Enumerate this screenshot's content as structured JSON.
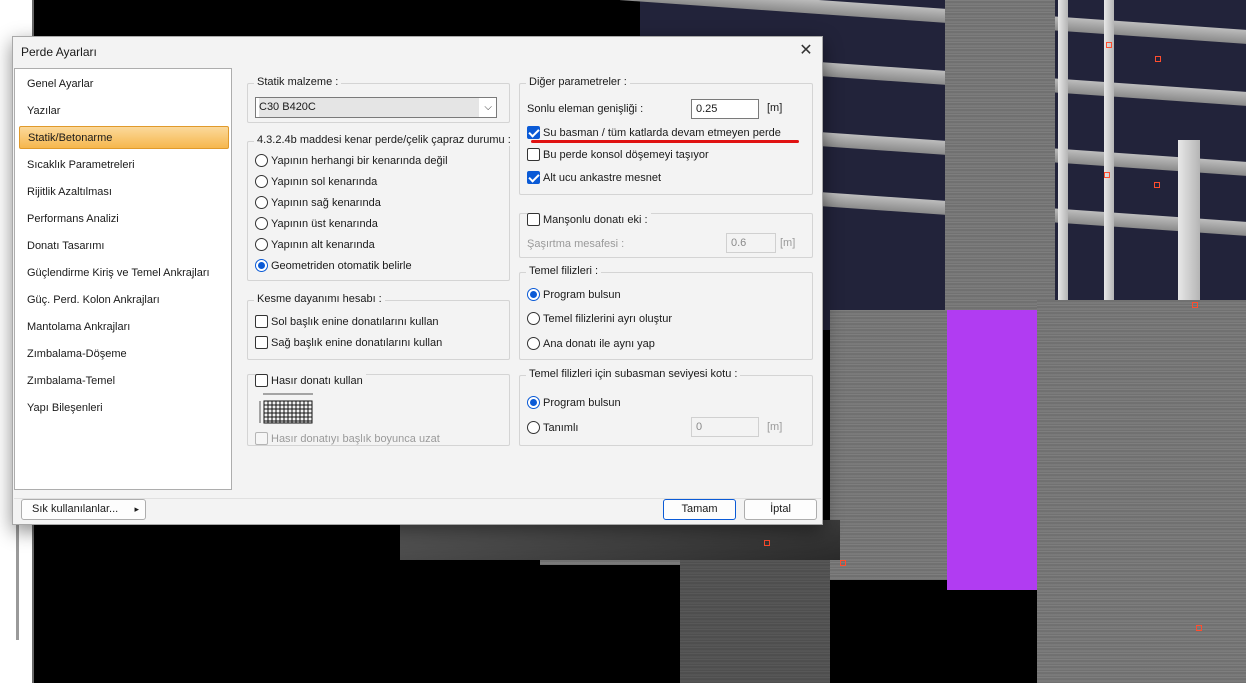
{
  "dialog": {
    "title": "Perde Ayarları",
    "close_label": "✕"
  },
  "nav": {
    "items": [
      {
        "label": "Genel Ayarlar"
      },
      {
        "label": "Yazılar"
      },
      {
        "label": "Statik/Betonarme",
        "active": true
      },
      {
        "label": "Sıcaklık Parametreleri"
      },
      {
        "label": "Rijitlik Azaltılması"
      },
      {
        "label": "Performans Analizi"
      },
      {
        "label": "Donatı Tasarımı"
      },
      {
        "label": "Güçlendirme Kiriş ve Temel Ankrajları"
      },
      {
        "label": "Güç. Perd. Kolon Ankrajları"
      },
      {
        "label": "Mantolama Ankrajları"
      },
      {
        "label": "Zımbalama-Döşeme"
      },
      {
        "label": "Zımbalama-Temel"
      },
      {
        "label": "Yapı Bileşenleri"
      }
    ]
  },
  "left": {
    "material_group_title": "Statik malzeme :",
    "material_value": "C30 B420C",
    "edge_group_title": "4.3.2.4b maddesi kenar perde/çelik çapraz durumu :",
    "edge_options": [
      {
        "label": "Yapının herhangi bir kenarında değil",
        "checked": false
      },
      {
        "label": "Yapının sol kenarında",
        "checked": false
      },
      {
        "label": "Yapının sağ kenarında",
        "checked": false
      },
      {
        "label": "Yapının üst kenarında",
        "checked": false
      },
      {
        "label": "Yapının alt kenarında",
        "checked": false
      },
      {
        "label": "Geometriden otomatik belirle",
        "checked": true
      }
    ],
    "shear_group_title": "Kesme dayanımı hesabı :",
    "shear_options": [
      {
        "label": "Sol başlık enine donatılarını kullan",
        "checked": false
      },
      {
        "label": "Sağ başlık enine donatılarını kullan",
        "checked": false
      }
    ],
    "mesh_check_label": "Hasır donatı kullan",
    "mesh_extend_label": "Hasır donatıyı başlık boyunca uzat"
  },
  "right": {
    "other_group_title": "Diğer parametreler :",
    "fe_width_label": "Sonlu eleman genişliği :",
    "fe_width_value": "0.25",
    "fe_width_unit": "[m]",
    "checks": [
      {
        "label": "Su basman / tüm katlarda devam etmeyen perde",
        "checked": true
      },
      {
        "label": "Bu perde konsol döşemeyi taşıyor",
        "checked": false
      },
      {
        "label": "Alt ucu ankastre mesnet",
        "checked": true
      }
    ],
    "sleeve_label": "Manşonlu donatı eki :",
    "stagger_label": "Şaşırtma mesafesi :",
    "stagger_value": "0.6",
    "stagger_unit": "[m]",
    "foundation_group_title": "Temel filizleri :",
    "foundation_options": [
      {
        "label": "Program bulsun",
        "checked": true
      },
      {
        "label": "Temel filizlerini ayrı oluştur",
        "checked": false
      },
      {
        "label": "Ana donatı ile aynı yap",
        "checked": false
      }
    ],
    "plinth_group_title": "Temel filizleri için subasman seviyesi kotu  :",
    "plinth_options": [
      {
        "label": "Program bulsun",
        "checked": true
      },
      {
        "label": "Tanımlı",
        "checked": false
      }
    ],
    "plinth_value": "0",
    "plinth_unit": "[m]"
  },
  "footer": {
    "favorites_label": "Sık kullanılanlar...",
    "favorites_arrow": "▸",
    "ok_label": "Tamam",
    "cancel_label": "İptal"
  },
  "colors": {
    "accent": "#0a5ad6",
    "active_nav": "#f6b74d",
    "annotation_underline": "#e01212",
    "highlight_wall": "#b13cf2"
  }
}
